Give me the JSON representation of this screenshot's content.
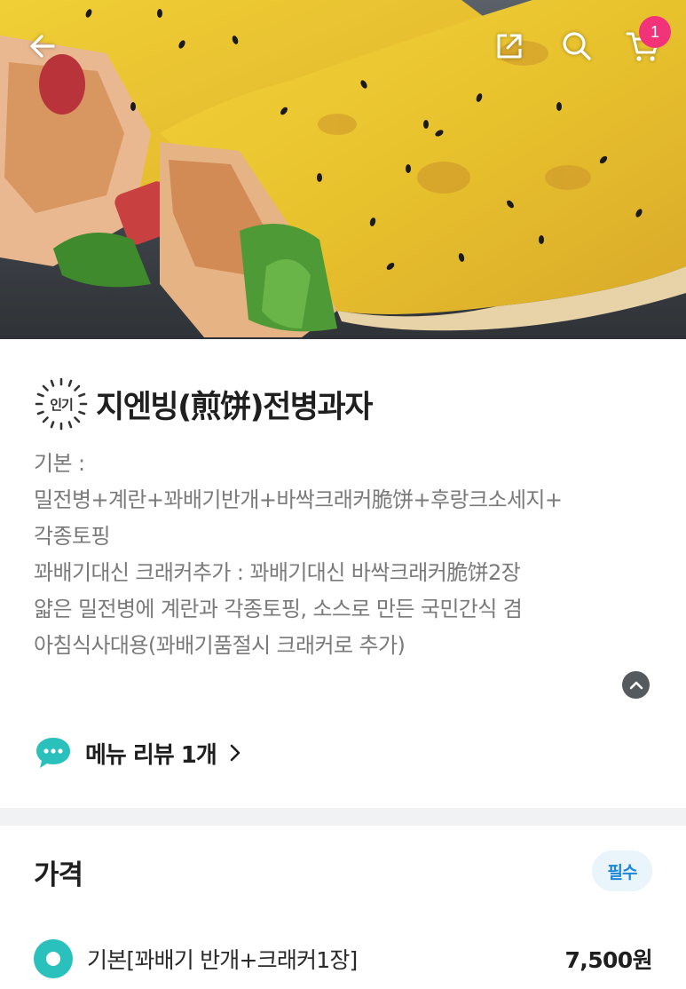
{
  "header": {
    "cart_count": "1",
    "icons": [
      "back-arrow-icon",
      "share-icon",
      "search-icon",
      "cart-icon"
    ]
  },
  "menu": {
    "badge": "인기",
    "title": "지엔빙(煎饼)전병과자",
    "description_lines": [
      "기본 :",
      "밀전병+계란+꽈배기반개+바싹크래커脆饼+후랑크소세지+",
      "각종토핑",
      "꽈배기대신 크래커추가 : 꽈배기대신 바싹크래커脆饼2장",
      "얇은 밀전병에 계란과 각종토핑, 소스로 만든 국민간식 겸",
      "아침식사대용(꽈배기품절시 크래커로 추가)"
    ]
  },
  "review": {
    "label": "메뉴 리뷰 1개"
  },
  "price_section": {
    "title": "가격",
    "required_label": "필수",
    "options": [
      {
        "label": "기본[꽈배기 반개+크래커1장]",
        "price": "7,500원",
        "selected": true
      }
    ]
  },
  "colors": {
    "accent_mint": "#2ac1bc",
    "badge_pink": "#f2337a",
    "required_blue": "#1c86d8"
  }
}
